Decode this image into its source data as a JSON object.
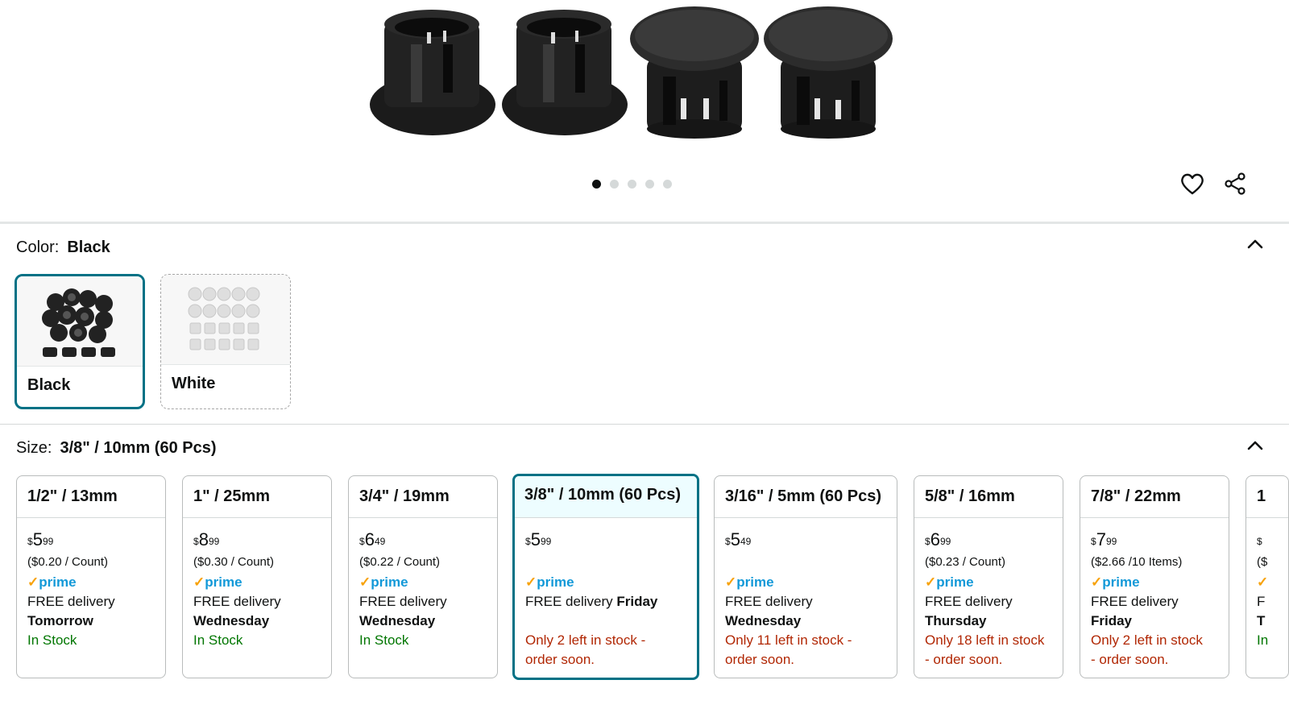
{
  "color_section": {
    "label": "Color:",
    "selected": "Black",
    "options": [
      {
        "label": "Black",
        "selected": true
      },
      {
        "label": "White",
        "selected": false
      }
    ]
  },
  "size_section": {
    "label": "Size:",
    "selected": "3/8\" / 10mm (60 Pcs)",
    "options": [
      {
        "title": "1/2\" / 13mm",
        "currency": "$",
        "whole": "5",
        "cents": "99",
        "unit": "($0.20 / Count)",
        "prime": "prime",
        "delivery": "FREE delivery",
        "day": "Tomorrow",
        "stock": "In Stock",
        "stock_status": "in"
      },
      {
        "title": "1\" / 25mm",
        "currency": "$",
        "whole": "8",
        "cents": "99",
        "unit": "($0.30 / Count)",
        "prime": "prime",
        "delivery": "FREE delivery",
        "day": "Wednesday",
        "stock": "In Stock",
        "stock_status": "in"
      },
      {
        "title": "3/4\" / 19mm",
        "currency": "$",
        "whole": "6",
        "cents": "49",
        "unit": "($0.22 / Count)",
        "prime": "prime",
        "delivery": "FREE delivery",
        "day": "Wednesday",
        "stock": "In Stock",
        "stock_status": "in"
      },
      {
        "title": "3/8\" / 10mm (60 Pcs)",
        "currency": "$",
        "whole": "5",
        "cents": "99",
        "unit": "",
        "prime": "prime",
        "delivery": "FREE delivery",
        "day": "Friday",
        "stock_line1": "Only 2 left in stock -",
        "stock_line2": "order soon.",
        "stock_status": "low"
      },
      {
        "title": "3/16\" / 5mm (60 Pcs)",
        "currency": "$",
        "whole": "5",
        "cents": "49",
        "unit": "",
        "prime": "prime",
        "delivery": "FREE delivery",
        "day": "Wednesday",
        "stock_line1": "Only 11 left in stock -",
        "stock_line2": "order soon.",
        "stock_status": "low"
      },
      {
        "title": "5/8\" / 16mm",
        "currency": "$",
        "whole": "6",
        "cents": "99",
        "unit": "($0.23 / Count)",
        "prime": "prime",
        "delivery": "FREE delivery",
        "day": "Thursday",
        "stock_line1": "Only 18 left in stock",
        "stock_line2": "- order soon.",
        "stock_status": "low"
      },
      {
        "title": "7/8\" / 22mm",
        "currency": "$",
        "whole": "7",
        "cents": "99",
        "unit": "($2.66 /10 Items)",
        "prime": "prime",
        "delivery": "FREE delivery",
        "day": "Friday",
        "stock_line1": "Only 2 left in stock",
        "stock_line2": "- order soon.",
        "stock_status": "low"
      },
      {
        "title": "1",
        "currency": "$",
        "whole": "",
        "cents": "",
        "unit": "($",
        "prime": "",
        "delivery": "F",
        "day": "T",
        "stock": "In",
        "stock_status": "in"
      }
    ]
  },
  "carousel": {
    "total": 5,
    "active": 0
  },
  "icons": {
    "favorite": "heart-icon",
    "share": "share-icon",
    "collapse": "chevron-up-icon",
    "prime_check": "check-icon"
  },
  "colors": {
    "accent": "#007185",
    "in_stock": "#007600",
    "low_stock": "#b12704",
    "prime_blue": "#1399d8",
    "prime_check": "#f7a20c"
  }
}
